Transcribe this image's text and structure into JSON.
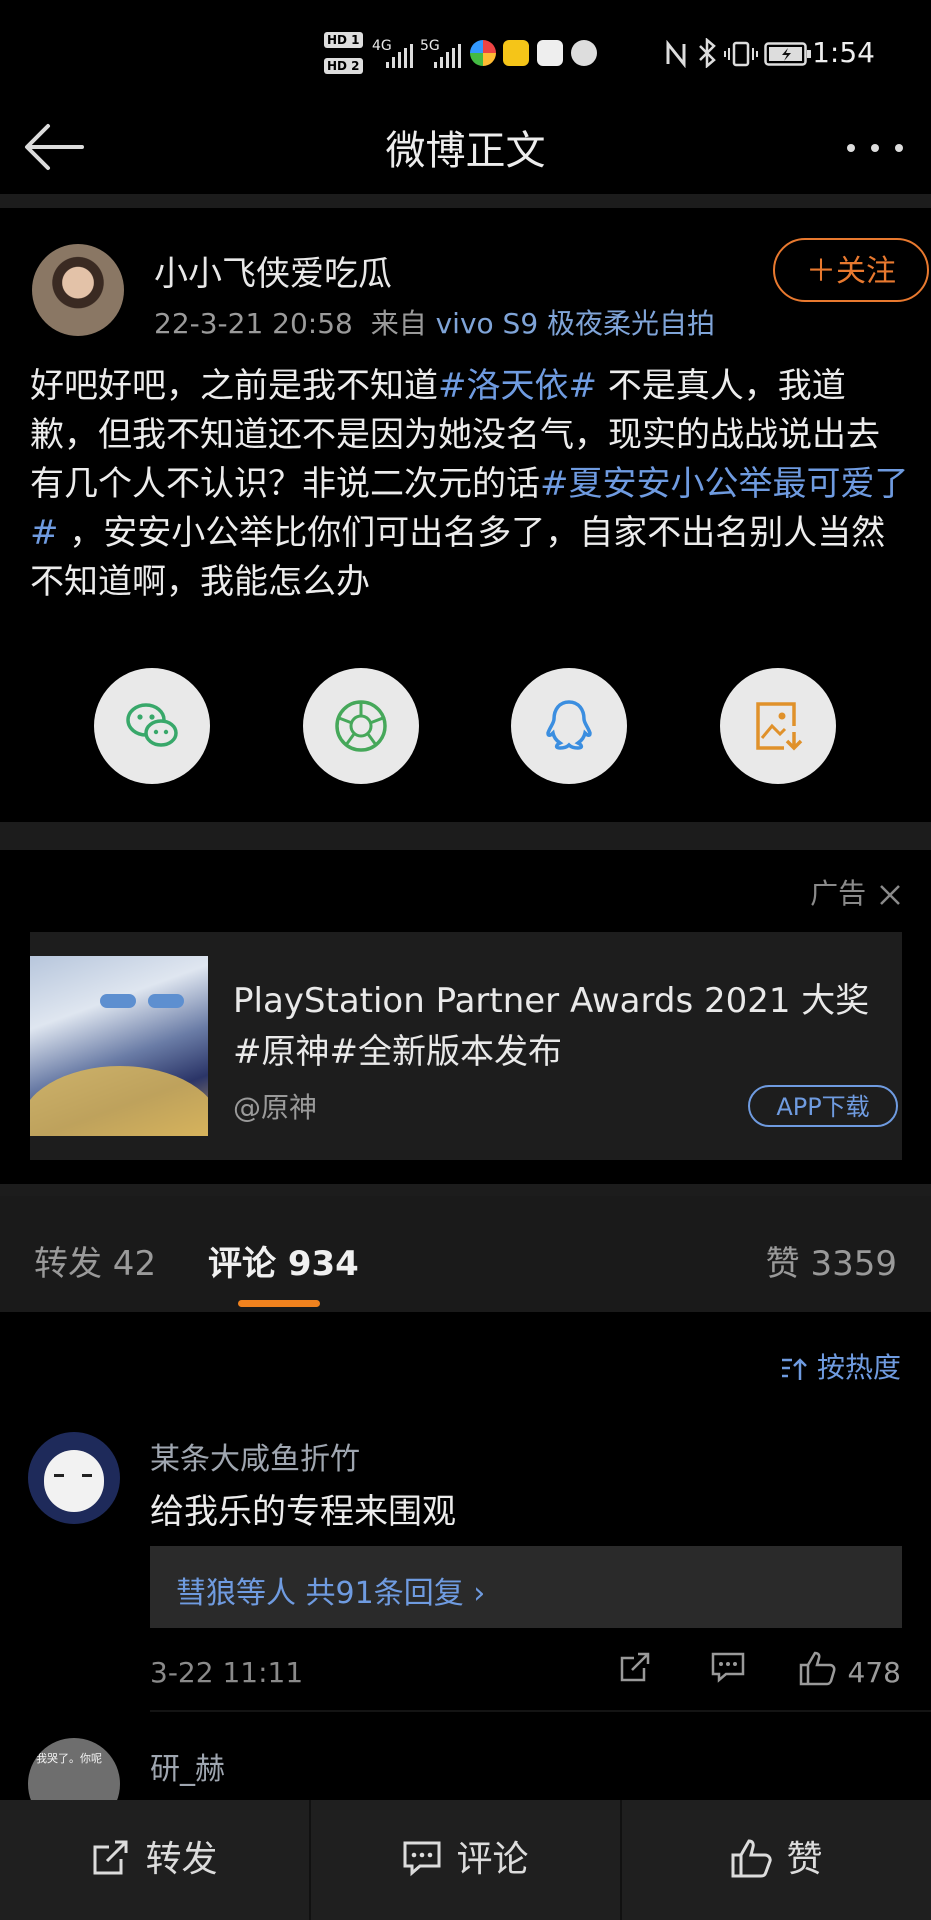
{
  "status_bar": {
    "network_1": "4G",
    "network_2": "5G",
    "hd1": "HD 1",
    "hd2": "HD 2",
    "time": "1:54"
  },
  "header": {
    "title": "微博正文"
  },
  "post": {
    "username": "小小飞侠爱吃瓜",
    "date": "22-3-21 20:58",
    "source_prefix": "来自",
    "source": "vivo S9 极夜柔光自拍",
    "follow_label": "＋关注",
    "text_1": "好吧好吧，之前是我不知道",
    "tag_1": "#洛天依#",
    "text_2": " 不是真人，我道歉，但我不知道还不是因为她没名气，现实的战战说出去有几个人不认识？非说二次元的话",
    "tag_2": "#夏安安小公举最可爱了#",
    "text_3": " ，安安小公举比你们可出名多了，自家不出名别人当然不知道啊，我能怎么办"
  },
  "share_icons": [
    "wechat-icon",
    "moments-icon",
    "qq-icon",
    "save-image-icon"
  ],
  "ad": {
    "label": "广告",
    "title": "PlayStation Partner Awards 2021 大奖 #原神#全新版本发布",
    "author": "@原神",
    "button": "APP下载"
  },
  "tabs": {
    "repost": "转发 42",
    "comment": "评论 934",
    "like": "赞 3359"
  },
  "sort_label": "按热度",
  "comments": [
    {
      "name": "某条大咸鱼折竹",
      "text": "给我乐的专程来围观",
      "reply_summary": "彗狼等人  共91条回复 ›",
      "time": "3-22 11:11",
      "likes": "478"
    },
    {
      "name": "研_赫",
      "avatar_caption": "我哭了。你呢"
    }
  ],
  "bottom_bar": {
    "repost": "转发",
    "comment": "评论",
    "like": "赞"
  },
  "colors": {
    "accent_orange": "#e8792f",
    "link_blue": "#6f9be0",
    "background": "#000000"
  }
}
